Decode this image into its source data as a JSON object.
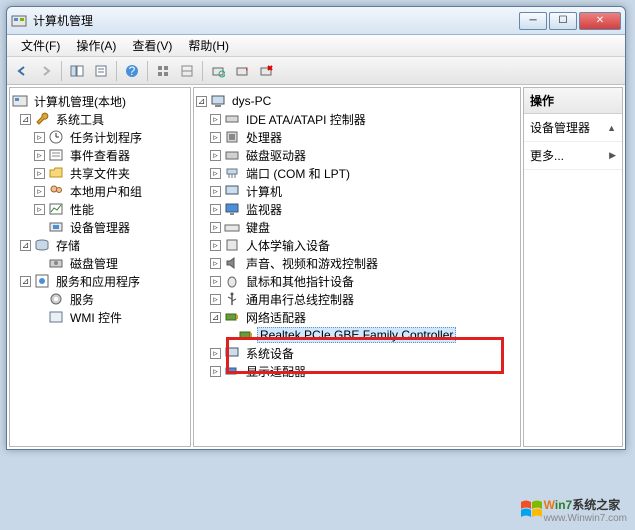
{
  "window": {
    "title": "计算机管理"
  },
  "menu": {
    "file": "文件(F)",
    "action": "操作(A)",
    "view": "查看(V)",
    "help": "帮助(H)"
  },
  "left_tree": {
    "root": "计算机管理(本地)",
    "system_tools": "系统工具",
    "task_scheduler": "任务计划程序",
    "event_viewer": "事件查看器",
    "shared_folders": "共享文件夹",
    "local_users": "本地用户和组",
    "performance": "性能",
    "device_manager": "设备管理器",
    "storage": "存储",
    "disk_mgmt": "磁盘管理",
    "services_apps": "服务和应用程序",
    "services": "服务",
    "wmi": "WMI 控件"
  },
  "mid_tree": {
    "root": "dys-PC",
    "ide": "IDE ATA/ATAPI 控制器",
    "cpu": "处理器",
    "disk_drives": "磁盘驱动器",
    "ports": "端口 (COM 和 LPT)",
    "computer": "计算机",
    "monitors": "监视器",
    "keyboards": "键盘",
    "hid": "人体学输入设备",
    "sound": "声音、视频和游戏控制器",
    "mouse": "鼠标和其他指针设备",
    "usb": "通用串行总线控制器",
    "network": "网络适配器",
    "realtek": "Realtek PCIe GBE Family Controller",
    "system_devices": "系统设备",
    "display": "显示适配器"
  },
  "right": {
    "head": "操作",
    "item1": "设备管理器",
    "item2": "更多..."
  },
  "watermark": {
    "brand": "Win7系统之家",
    "url": "www.Winwin7.com"
  }
}
